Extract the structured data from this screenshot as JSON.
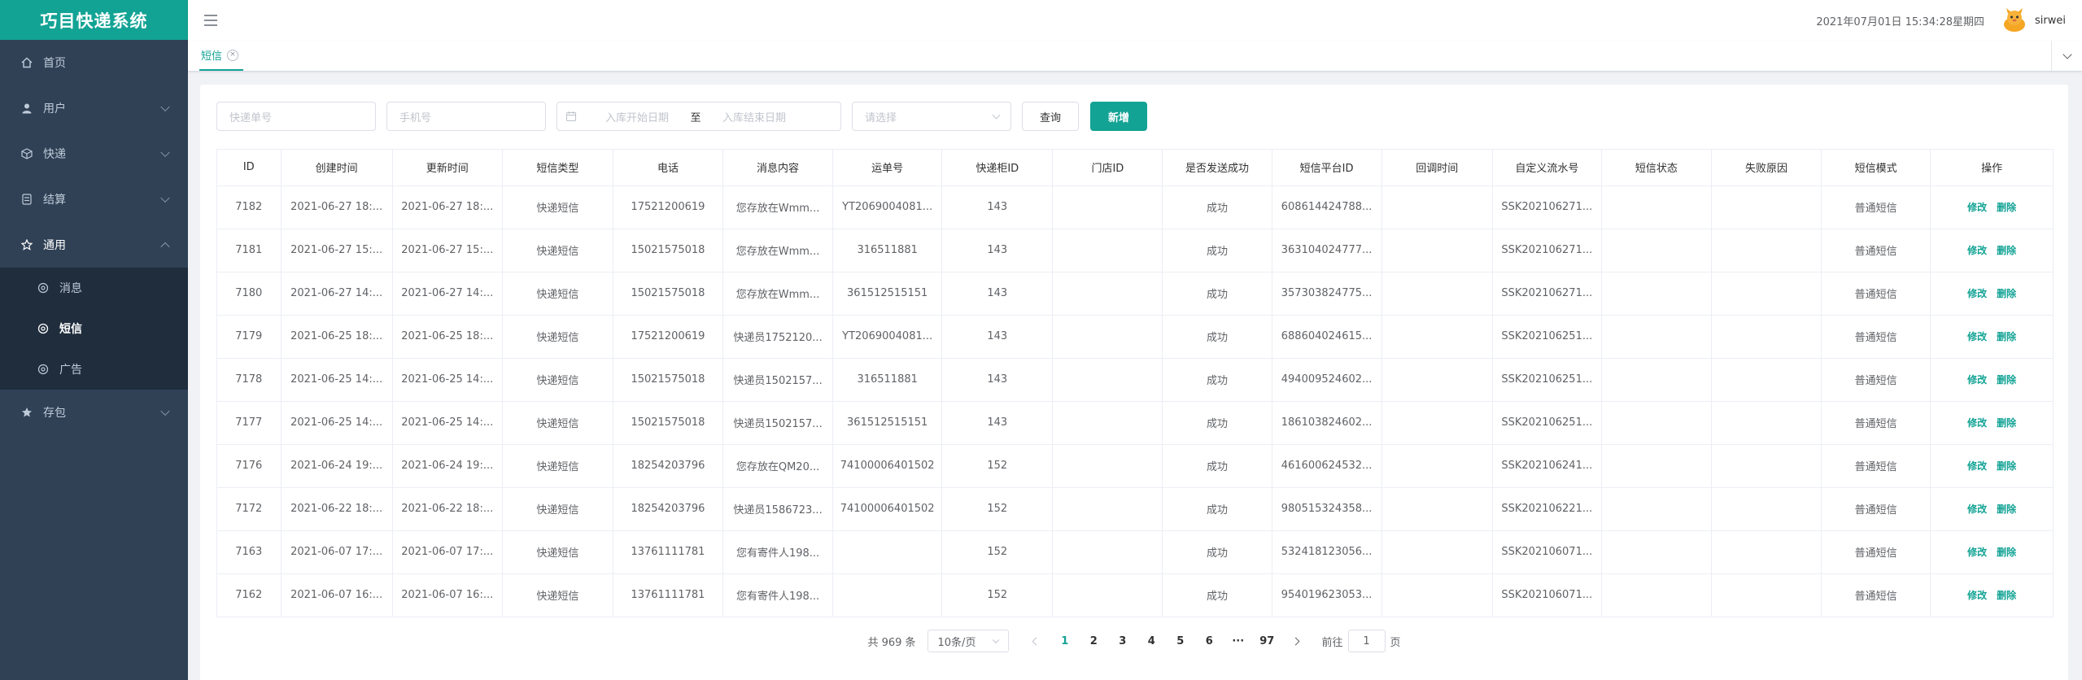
{
  "app": {
    "title": "巧目快递系统"
  },
  "sidebar": {
    "items": [
      {
        "label": "首页",
        "icon": "home-icon"
      },
      {
        "label": "用户",
        "icon": "user-icon"
      },
      {
        "label": "快递",
        "icon": "package-icon"
      },
      {
        "label": "结算",
        "icon": "calculator-icon"
      },
      {
        "label": "通用",
        "icon": "star-icon"
      },
      {
        "label": "存包",
        "icon": "star-icon"
      }
    ],
    "submenu": [
      {
        "label": "消息",
        "icon": "gear-icon"
      },
      {
        "label": "短信",
        "icon": "gear-icon"
      },
      {
        "label": "广告",
        "icon": "gear-icon"
      }
    ]
  },
  "header": {
    "datetime": "2021年07月01日 15:34:28星期四",
    "username": "sirwei"
  },
  "tabs": [
    {
      "label": "短信",
      "close": "×"
    }
  ],
  "filters": {
    "tracking_placeholder": "快递单号",
    "phone_placeholder": "手机号",
    "date_start_placeholder": "入库开始日期",
    "date_separator": "至",
    "date_end_placeholder": "入库结束日期",
    "select_placeholder": "请选择",
    "query_label": "查询",
    "add_label": "新增"
  },
  "table": {
    "columns": [
      "ID",
      "创建时间",
      "更新时间",
      "短信类型",
      "电话",
      "消息内容",
      "运单号",
      "快递柜ID",
      "门店ID",
      "是否发送成功",
      "短信平台ID",
      "回调时间",
      "自定义流水号",
      "短信状态",
      "失败原因",
      "短信模式",
      "操作"
    ],
    "edit_label": "修改",
    "delete_label": "删除",
    "rows": [
      [
        "7182",
        "2021-06-27 18:...",
        "2021-06-27 18:...",
        "快递短信",
        "17521200619",
        "您存放在Wmm...",
        "YT2069004081...",
        "143",
        "",
        "成功",
        "608614424788...",
        "",
        "SSK202106271...",
        "",
        "",
        "普通短信"
      ],
      [
        "7181",
        "2021-06-27 15:...",
        "2021-06-27 15:...",
        "快递短信",
        "15021575018",
        "您存放在Wmm...",
        "316511881",
        "143",
        "",
        "成功",
        "363104024777...",
        "",
        "SSK202106271...",
        "",
        "",
        "普通短信"
      ],
      [
        "7180",
        "2021-06-27 14:...",
        "2021-06-27 14:...",
        "快递短信",
        "15021575018",
        "您存放在Wmm...",
        "361512515151",
        "143",
        "",
        "成功",
        "357303824775...",
        "",
        "SSK202106271...",
        "",
        "",
        "普通短信"
      ],
      [
        "7179",
        "2021-06-25 18:...",
        "2021-06-25 18:...",
        "快递短信",
        "17521200619",
        "快递员1752120...",
        "YT2069004081...",
        "143",
        "",
        "成功",
        "688604024615...",
        "",
        "SSK202106251...",
        "",
        "",
        "普通短信"
      ],
      [
        "7178",
        "2021-06-25 14:...",
        "2021-06-25 14:...",
        "快递短信",
        "15021575018",
        "快递员1502157...",
        "316511881",
        "143",
        "",
        "成功",
        "494009524602...",
        "",
        "SSK202106251...",
        "",
        "",
        "普通短信"
      ],
      [
        "7177",
        "2021-06-25 14:...",
        "2021-06-25 14:...",
        "快递短信",
        "15021575018",
        "快递员1502157...",
        "361512515151",
        "143",
        "",
        "成功",
        "186103824602...",
        "",
        "SSK202106251...",
        "",
        "",
        "普通短信"
      ],
      [
        "7176",
        "2021-06-24 19:...",
        "2021-06-24 19:...",
        "快递短信",
        "18254203796",
        "您存放在QM20...",
        "74100006401502",
        "152",
        "",
        "成功",
        "461600624532...",
        "",
        "SSK202106241...",
        "",
        "",
        "普通短信"
      ],
      [
        "7172",
        "2021-06-22 18:...",
        "2021-06-22 18:...",
        "快递短信",
        "18254203796",
        "快递员1586723...",
        "74100006401502",
        "152",
        "",
        "成功",
        "980515324358...",
        "",
        "SSK202106221...",
        "",
        "",
        "普通短信"
      ],
      [
        "7163",
        "2021-06-07 17:...",
        "2021-06-07 17:...",
        "快递短信",
        "13761111781",
        "您有寄件人198...",
        "",
        "152",
        "",
        "成功",
        "532418123056...",
        "",
        "SSK202106071...",
        "",
        "",
        "普通短信"
      ],
      [
        "7162",
        "2021-06-07 16:...",
        "2021-06-07 16:...",
        "快递短信",
        "13761111781",
        "您有寄件人198...",
        "",
        "152",
        "",
        "成功",
        "954019623053...",
        "",
        "SSK202106071...",
        "",
        "",
        "普通短信"
      ]
    ]
  },
  "pagination": {
    "total_text": "共 969 条",
    "page_size": "10条/页",
    "pages": [
      "1",
      "2",
      "3",
      "4",
      "5",
      "6",
      "···",
      "97"
    ],
    "current": "1",
    "goto_label": "前往",
    "goto_value": "1",
    "page_suffix": "页"
  },
  "colors": {
    "accent": "#13a395",
    "sidebar_bg": "#304156",
    "submenu_bg": "#1f2d3d"
  }
}
